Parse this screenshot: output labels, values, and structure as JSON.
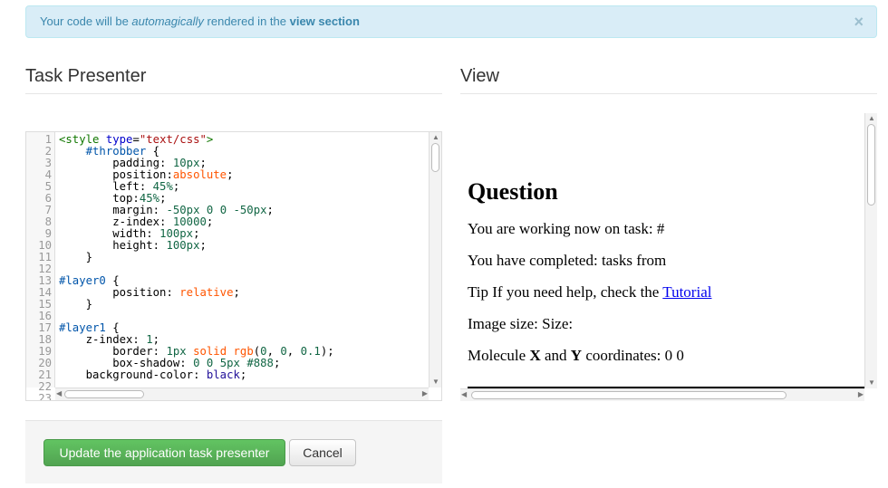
{
  "alert": {
    "prefix": "Your code will be ",
    "emphasis": "automagically",
    "middle": " rendered in the ",
    "bold": "view section",
    "close": "×"
  },
  "headings": {
    "left": "Task Presenter",
    "right": "View"
  },
  "editor": {
    "lines": [
      [
        {
          "t": "<",
          "c": "c-tag"
        },
        {
          "t": "style",
          "c": "c-tag"
        },
        {
          "t": " ",
          "c": "c-plain"
        },
        {
          "t": "type",
          "c": "c-attr"
        },
        {
          "t": "=",
          "c": "c-plain"
        },
        {
          "t": "\"text/css\"",
          "c": "c-str"
        },
        {
          "t": ">",
          "c": "c-tag"
        }
      ],
      [
        {
          "t": "    ",
          "c": "c-plain"
        },
        {
          "t": "#throbber",
          "c": "c-sel"
        },
        {
          "t": " {",
          "c": "c-plain"
        }
      ],
      [
        {
          "t": "        padding: ",
          "c": "c-prop"
        },
        {
          "t": "10px",
          "c": "c-num"
        },
        {
          "t": ";",
          "c": "c-plain"
        }
      ],
      [
        {
          "t": "        position:",
          "c": "c-prop"
        },
        {
          "t": "absolute",
          "c": "c-kw"
        },
        {
          "t": ";",
          "c": "c-plain"
        }
      ],
      [
        {
          "t": "        left: ",
          "c": "c-prop"
        },
        {
          "t": "45%",
          "c": "c-num"
        },
        {
          "t": ";",
          "c": "c-plain"
        }
      ],
      [
        {
          "t": "        top:",
          "c": "c-prop"
        },
        {
          "t": "45%",
          "c": "c-num"
        },
        {
          "t": ";",
          "c": "c-plain"
        }
      ],
      [
        {
          "t": "        margin: ",
          "c": "c-prop"
        },
        {
          "t": "-50px 0 0 -50px",
          "c": "c-num"
        },
        {
          "t": ";",
          "c": "c-plain"
        }
      ],
      [
        {
          "t": "        z-index: ",
          "c": "c-prop"
        },
        {
          "t": "10000",
          "c": "c-num"
        },
        {
          "t": ";",
          "c": "c-plain"
        }
      ],
      [
        {
          "t": "        width: ",
          "c": "c-prop"
        },
        {
          "t": "100px",
          "c": "c-num"
        },
        {
          "t": ";",
          "c": "c-plain"
        }
      ],
      [
        {
          "t": "        height: ",
          "c": "c-prop"
        },
        {
          "t": "100px",
          "c": "c-num"
        },
        {
          "t": ";",
          "c": "c-plain"
        }
      ],
      [
        {
          "t": "    }",
          "c": "c-plain"
        }
      ],
      [
        {
          "t": "",
          "c": "c-plain"
        }
      ],
      [
        {
          "t": "#layer0",
          "c": "c-sel"
        },
        {
          "t": " {",
          "c": "c-plain"
        }
      ],
      [
        {
          "t": "        position: ",
          "c": "c-prop"
        },
        {
          "t": "relative",
          "c": "c-kw"
        },
        {
          "t": ";",
          "c": "c-plain"
        }
      ],
      [
        {
          "t": "    }",
          "c": "c-plain"
        }
      ],
      [
        {
          "t": "",
          "c": "c-plain"
        }
      ],
      [
        {
          "t": "#layer1",
          "c": "c-sel"
        },
        {
          "t": " {",
          "c": "c-plain"
        }
      ],
      [
        {
          "t": "    z-index: ",
          "c": "c-prop"
        },
        {
          "t": "1",
          "c": "c-num"
        },
        {
          "t": ";",
          "c": "c-plain"
        }
      ],
      [
        {
          "t": "        border: ",
          "c": "c-prop"
        },
        {
          "t": "1px",
          "c": "c-num"
        },
        {
          "t": " ",
          "c": "c-plain"
        },
        {
          "t": "solid",
          "c": "c-kw"
        },
        {
          "t": " ",
          "c": "c-plain"
        },
        {
          "t": "rgb",
          "c": "c-kw"
        },
        {
          "t": "(",
          "c": "c-plain"
        },
        {
          "t": "0",
          "c": "c-num"
        },
        {
          "t": ", ",
          "c": "c-plain"
        },
        {
          "t": "0",
          "c": "c-num"
        },
        {
          "t": ", ",
          "c": "c-plain"
        },
        {
          "t": "0.1",
          "c": "c-num"
        },
        {
          "t": ");",
          "c": "c-plain"
        }
      ],
      [
        {
          "t": "        box-shadow: ",
          "c": "c-prop"
        },
        {
          "t": "0 0 5px",
          "c": "c-num"
        },
        {
          "t": " ",
          "c": "c-plain"
        },
        {
          "t": "#888",
          "c": "c-num"
        },
        {
          "t": ";",
          "c": "c-plain"
        }
      ],
      [
        {
          "t": "    background-color: ",
          "c": "c-prop"
        },
        {
          "t": "black",
          "c": "c-atom"
        },
        {
          "t": ";",
          "c": "c-plain"
        }
      ],
      [
        {
          "t": "",
          "c": "c-plain"
        }
      ],
      [
        {
          "t": "",
          "c": "c-plain"
        }
      ]
    ]
  },
  "view": {
    "title": "Question",
    "task_line": "You are working now on task: #",
    "completed_line": "You have completed: tasks from",
    "tip_prefix": "Tip If you need help, check the ",
    "tip_link": "Tutorial",
    "image_line": "Image size: Size:",
    "molecule_prefix": "Molecule ",
    "molecule_x": "X",
    "molecule_and": " and ",
    "molecule_y": "Y",
    "molecule_suffix": " coordinates: 0 0"
  },
  "actions": {
    "update_label": "Update the application task presenter",
    "cancel_label": "Cancel"
  },
  "colors": {
    "alert_bg": "#d9edf7",
    "alert_text": "#3a87ad",
    "success": "#5bb75b"
  }
}
